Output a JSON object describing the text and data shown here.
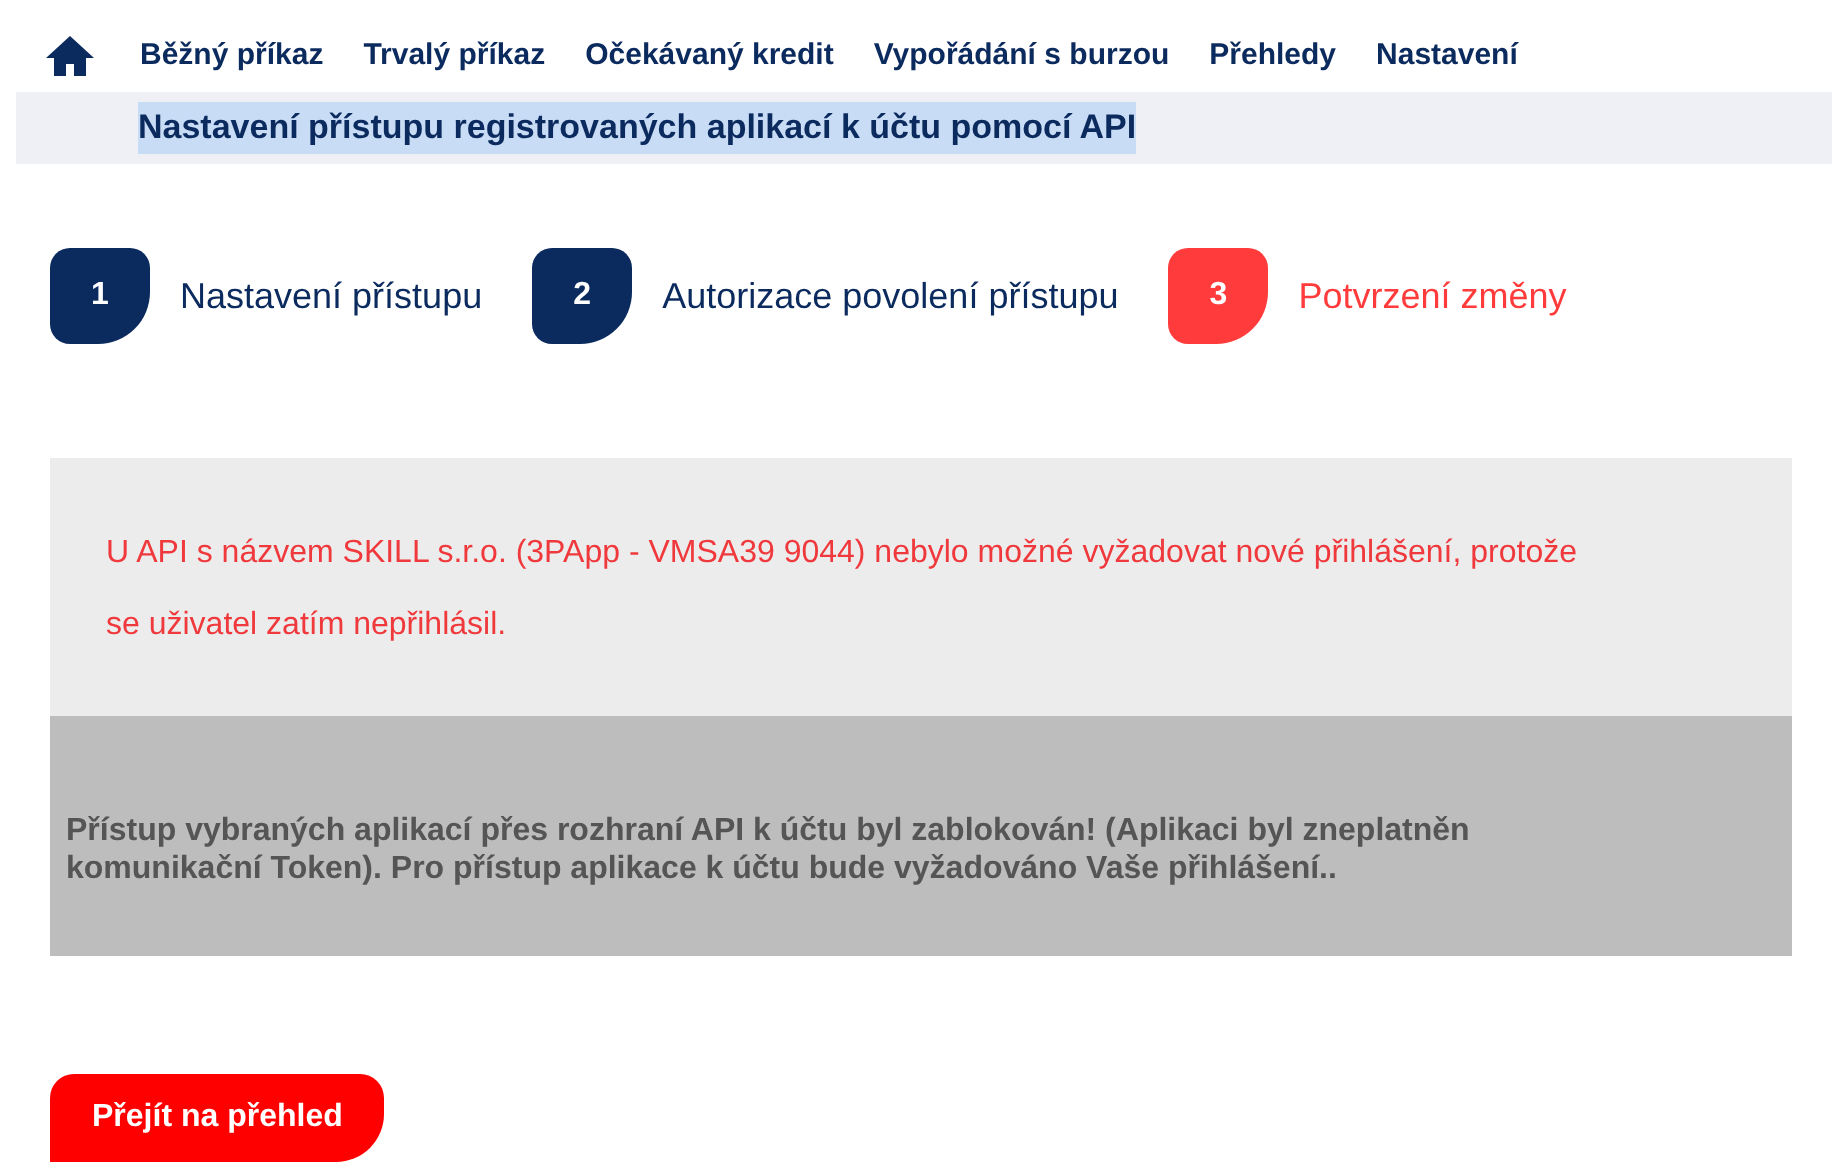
{
  "nav": {
    "items": [
      "Běžný příkaz",
      "Trvalý příkaz",
      "Očekávaný kredit",
      "Vypořádání s burzou",
      "Přehledy",
      "Nastavení"
    ]
  },
  "page_title": "Nastavení přístupu registrovaných aplikací k účtu pomocí API",
  "steps": [
    {
      "number": "1",
      "label": "Nastavení přístupu",
      "selected": false
    },
    {
      "number": "2",
      "label": "Autorizace povolení přístupu",
      "selected": false
    },
    {
      "number": "3",
      "label": "Potvrzení změny",
      "selected": true
    }
  ],
  "error_message": "U API s názvem SKILL s.r.o. (3PApp - VMSA39 9044) nebylo možné vyžadovat nové přihlášení, protože se uživatel zatím nepřihlásil.",
  "info_message": "Přístup vybraných aplikací přes rozhraní API k účtu byl zablokován! (Aplikaci byl zneplatněn komunikační Token). Pro přístup aplikace k účtu bude vyžadováno Vaše přihlášení..",
  "primary_button": "Přejít na přehled"
}
